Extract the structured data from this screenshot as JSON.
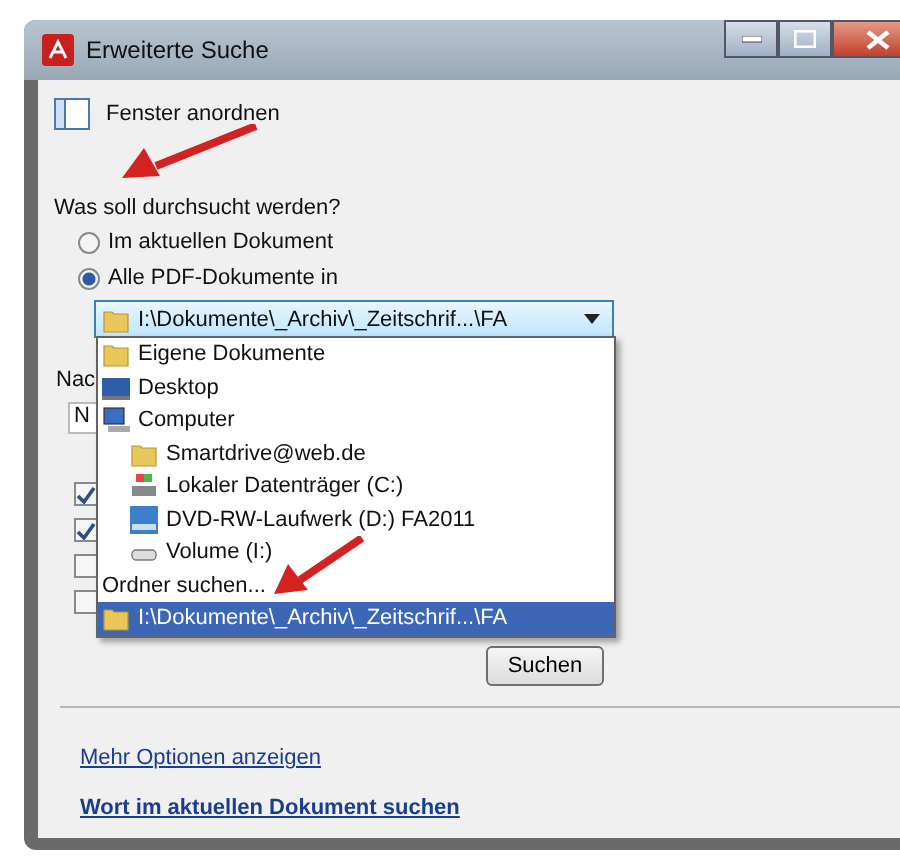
{
  "window": {
    "title": "Erweiterte Suche"
  },
  "toolbar": {
    "label": "Fenster anordnen"
  },
  "question": "Was soll durchsucht werden?",
  "scope_options": [
    {
      "label": "Im aktuellen Dokument",
      "selected": false
    },
    {
      "label": "Alle PDF-Dokumente in",
      "selected": true
    }
  ],
  "location_combo": {
    "value": "I:\\Dokumente\\_Archiv\\_Zeitschrif...\\FA"
  },
  "dropdown_items": [
    {
      "kind": "folder",
      "label": "Eigene Dokumente",
      "selected": false
    },
    {
      "kind": "desktop",
      "label": "Desktop",
      "selected": false
    },
    {
      "kind": "computer",
      "label": "Computer",
      "selected": false,
      "children": [
        {
          "kind": "folder",
          "label": "Smartdrive@web.de",
          "selected": false
        },
        {
          "kind": "disk",
          "label": "Lokaler Datenträger (C:)",
          "selected": false
        },
        {
          "kind": "dvd",
          "label": "DVD-RW-Laufwerk (D:) FA2011",
          "selected": false
        },
        {
          "kind": "drive",
          "label": "Volume (I:)",
          "selected": false
        }
      ]
    },
    {
      "kind": "action",
      "label": "Ordner suchen...",
      "selected": false
    },
    {
      "kind": "folder",
      "label": "I:\\Dokumente\\_Archiv\\_Zeitschrif...\\FA",
      "selected": true
    }
  ],
  "hidden_label": "Nac",
  "hidden_field": {
    "value": "N"
  },
  "checkboxes": [
    {
      "checked": true
    },
    {
      "checked": true
    },
    {
      "checked": false
    },
    {
      "checked": false
    }
  ],
  "search_button": "Suchen",
  "links": [
    {
      "label": "Mehr Optionen anzeigen",
      "bold": false
    },
    {
      "label": "Wort im aktuellen Dokument suchen",
      "bold": true
    }
  ]
}
